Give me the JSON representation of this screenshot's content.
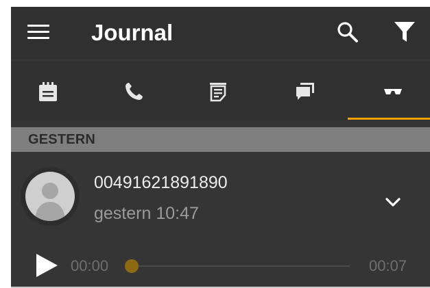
{
  "appbar": {
    "title": "Journal",
    "icons": [
      "menu-icon",
      "search-icon",
      "filter-icon"
    ]
  },
  "tabs": [
    {
      "icon": "calendar-icon",
      "selected": false
    },
    {
      "icon": "phone-icon",
      "selected": false
    },
    {
      "icon": "note-icon",
      "selected": false
    },
    {
      "icon": "chat-icon",
      "selected": false
    },
    {
      "icon": "voicemail-icon",
      "selected": true
    }
  ],
  "section": {
    "label": "GESTERN"
  },
  "entry": {
    "number": "00491621891890",
    "time": "gestern 10:47",
    "icons": [
      "avatar-icon",
      "chevron-down-icon",
      "play-icon"
    ],
    "player": {
      "start": "00:00",
      "end": "00:07",
      "progress": 0
    }
  },
  "colors": {
    "background": "#353535",
    "appbar": "#303030",
    "accent": "#f3a000",
    "section_header": "#7f7f7f",
    "slider_thumb": "#8c6a12"
  }
}
